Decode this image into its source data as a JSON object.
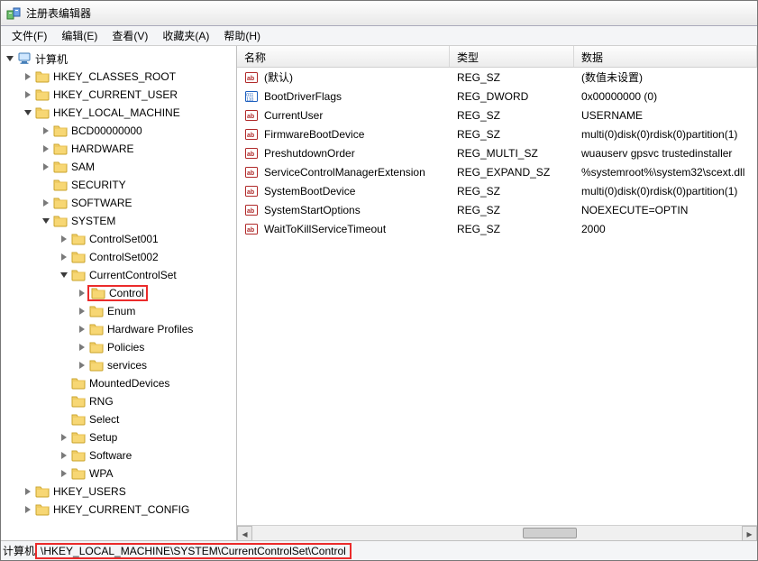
{
  "window": {
    "title": "注册表编辑器"
  },
  "menu": {
    "file": "文件(F)",
    "edit": "编辑(E)",
    "view": "查看(V)",
    "favorites": "收藏夹(A)",
    "help": "帮助(H)"
  },
  "tree": {
    "root": "计算机",
    "hkcr": "HKEY_CLASSES_ROOT",
    "hkcu": "HKEY_CURRENT_USER",
    "hklm": "HKEY_LOCAL_MACHINE",
    "bcd": "BCD00000000",
    "hardware": "HARDWARE",
    "sam": "SAM",
    "security": "SECURITY",
    "software": "SOFTWARE",
    "system": "SYSTEM",
    "cs001": "ControlSet001",
    "cs002": "ControlSet002",
    "ccs": "CurrentControlSet",
    "control": "Control",
    "enum": "Enum",
    "hwprof": "Hardware Profiles",
    "policies": "Policies",
    "services": "services",
    "mounted": "MountedDevices",
    "rng": "RNG",
    "select": "Select",
    "setup": "Setup",
    "software2": "Software",
    "wpa": "WPA",
    "hku": "HKEY_USERS",
    "hkcc": "HKEY_CURRENT_CONFIG"
  },
  "columns": {
    "name": "名称",
    "type": "类型",
    "data": "数据"
  },
  "values": [
    {
      "icon": "str",
      "name": "(默认)",
      "type": "REG_SZ",
      "data": "(数值未设置)"
    },
    {
      "icon": "bin",
      "name": "BootDriverFlags",
      "type": "REG_DWORD",
      "data": "0x00000000 (0)"
    },
    {
      "icon": "str",
      "name": "CurrentUser",
      "type": "REG_SZ",
      "data": "USERNAME"
    },
    {
      "icon": "str",
      "name": "FirmwareBootDevice",
      "type": "REG_SZ",
      "data": "multi(0)disk(0)rdisk(0)partition(1)"
    },
    {
      "icon": "str",
      "name": "PreshutdownOrder",
      "type": "REG_MULTI_SZ",
      "data": "wuauserv gpsvc trustedinstaller"
    },
    {
      "icon": "str",
      "name": "ServiceControlManagerExtension",
      "type": "REG_EXPAND_SZ",
      "data": "%systemroot%\\system32\\scext.dll"
    },
    {
      "icon": "str",
      "name": "SystemBootDevice",
      "type": "REG_SZ",
      "data": "multi(0)disk(0)rdisk(0)partition(1)"
    },
    {
      "icon": "str",
      "name": "SystemStartOptions",
      "type": "REG_SZ",
      "data": " NOEXECUTE=OPTIN"
    },
    {
      "icon": "str",
      "name": "WaitToKillServiceTimeout",
      "type": "REG_SZ",
      "data": "2000"
    }
  ],
  "status": {
    "prefix": "计算机",
    "path": "\\HKEY_LOCAL_MACHINE\\SYSTEM\\CurrentControlSet\\Control"
  }
}
